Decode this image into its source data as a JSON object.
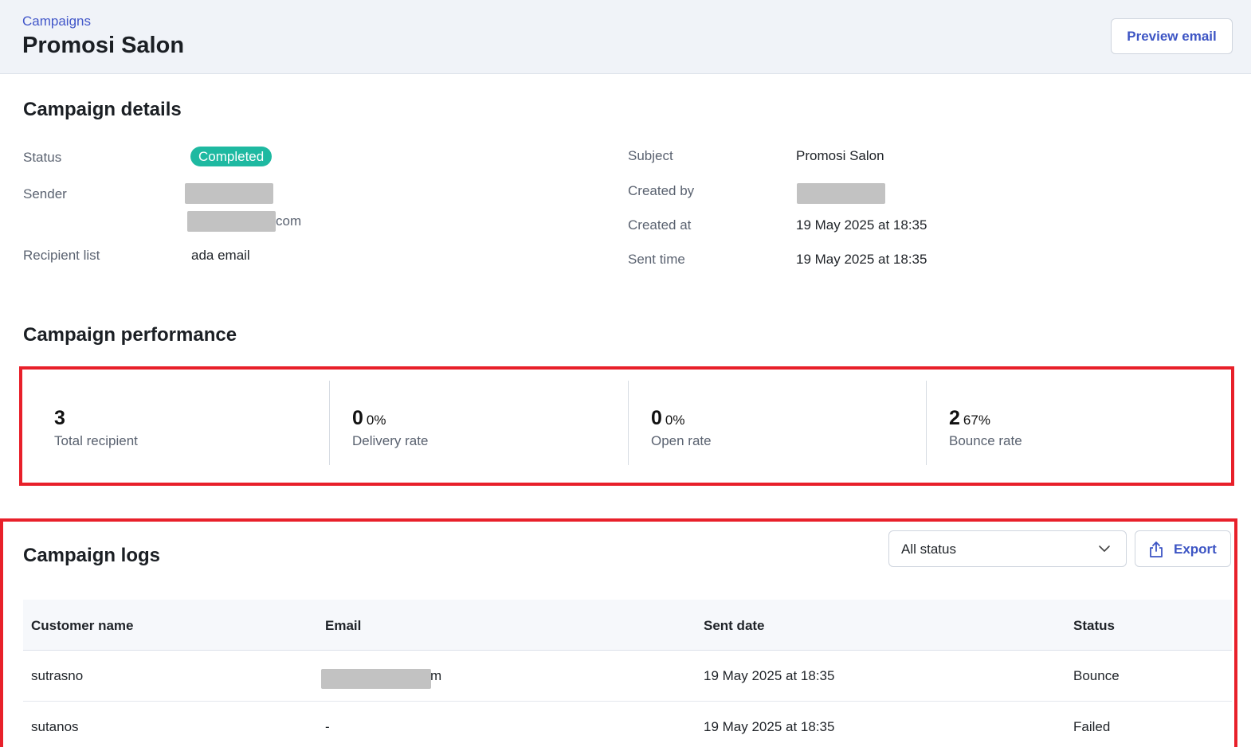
{
  "header": {
    "breadcrumb": "Campaigns",
    "title": "Promosi Salon",
    "preview_button": "Preview email"
  },
  "details": {
    "section_title": "Campaign details",
    "status_label": "Status",
    "status_value": "Completed",
    "sender_label": "Sender",
    "sender_email_suffix": "com",
    "recipient_list_label": "Recipient list",
    "recipient_list_value": "ada email",
    "subject_label": "Subject",
    "subject_value": "Promosi Salon",
    "created_by_label": "Created by",
    "created_at_label": "Created at",
    "created_at_value": "19 May 2025 at 18:35",
    "sent_time_label": "Sent time",
    "sent_time_value": "19 May 2025 at 18:35"
  },
  "performance": {
    "section_title": "Campaign performance",
    "metrics": [
      {
        "value": "3",
        "percent": "",
        "label": "Total recipient"
      },
      {
        "value": "0",
        "percent": "0%",
        "label": "Delivery rate"
      },
      {
        "value": "0",
        "percent": "0%",
        "label": "Open rate"
      },
      {
        "value": "2",
        "percent": "67%",
        "label": "Bounce rate"
      }
    ]
  },
  "logs": {
    "section_title": "Campaign logs",
    "filter_value": "All status",
    "export_button": "Export",
    "columns": [
      "Customer name",
      "Email",
      "Sent date",
      "Status"
    ],
    "rows": [
      {
        "name": "sutrasno",
        "email_suffix": "m",
        "sent_date": "19 May 2025 at 18:35",
        "status": "Bounce"
      },
      {
        "name": "sutanos",
        "email": "-",
        "sent_date": "19 May 2025 at 18:35",
        "status": "Failed"
      }
    ]
  },
  "colors": {
    "accent": "#3d55c4",
    "badge_completed": "#1eb9a1",
    "highlight": "#e8202a",
    "header_bg": "#f0f3f8"
  },
  "icons": [
    "chevron-down-icon",
    "export-upload-icon"
  ]
}
